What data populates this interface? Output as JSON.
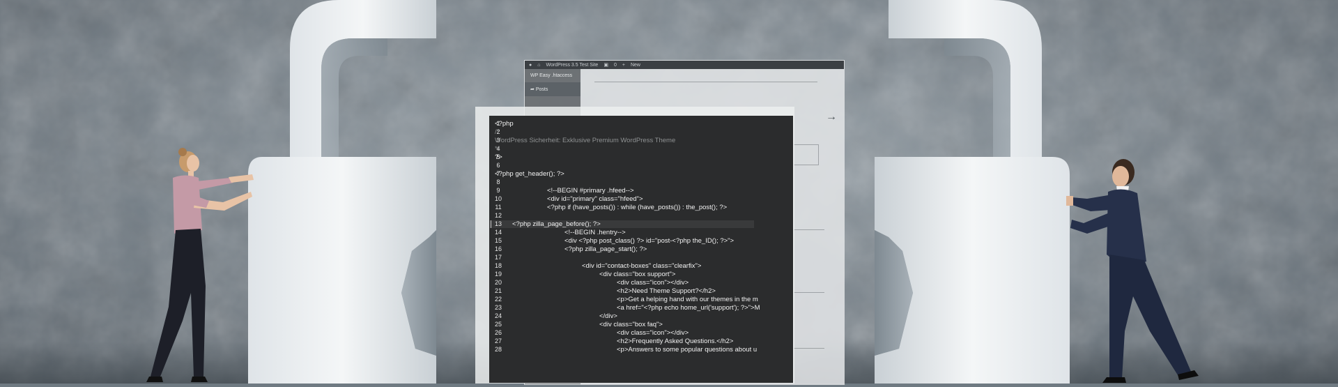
{
  "scene": {
    "description_tags": [
      "padlock-left",
      "padlock-right",
      "woman-pushing",
      "man-pushing",
      "code-editor",
      "wordpress-admin"
    ]
  },
  "wp_admin": {
    "site_title": "WordPress 3.5 Test Site",
    "comments_count": "0",
    "new_label": "New",
    "plugin_item": "WP Easy .htaccess",
    "posts_item": "Posts"
  },
  "editor": {
    "lines": [
      {
        "n": "1",
        "text": "<?php",
        "indent": 0,
        "comment": false
      },
      {
        "n": "2",
        "text": "/*",
        "indent": 0,
        "comment": true
      },
      {
        "n": "3",
        "text": "WordPress Sicherheit: Exklusive Premium WordPress Theme",
        "indent": 0,
        "comment": true
      },
      {
        "n": "4",
        "text": "*/",
        "indent": 0,
        "comment": true
      },
      {
        "n": "5",
        "text": "?>",
        "indent": 0,
        "comment": false
      },
      {
        "n": "6",
        "text": "",
        "indent": 0,
        "comment": false
      },
      {
        "n": "7",
        "text": "<?php get_header(); ?>",
        "indent": 0,
        "comment": false
      },
      {
        "n": "8",
        "text": "",
        "indent": 0,
        "comment": false
      },
      {
        "n": "9",
        "text": "<!--BEGIN #primary .hfeed-->",
        "indent": 3,
        "comment": false
      },
      {
        "n": "10",
        "text": "<div id=\"primary\" class=\"hfeed\">",
        "indent": 3,
        "comment": false
      },
      {
        "n": "11",
        "text": "<?php if (have_posts()) : while (have_posts()) : the_post(); ?>",
        "indent": 3,
        "comment": false
      },
      {
        "n": "12",
        "text": "",
        "indent": 0,
        "comment": false
      },
      {
        "n": "13",
        "text": "<?php zilla_page_before(); ?>",
        "indent": 1,
        "comment": false
      },
      {
        "n": "14",
        "text": "<!--BEGIN .hentry-->",
        "indent": 4,
        "comment": false
      },
      {
        "n": "15",
        "text": "<div <?php post_class() ?> id=\"post-<?php the_ID(); ?>\">",
        "indent": 4,
        "comment": false
      },
      {
        "n": "16",
        "text": "<?php zilla_page_start(); ?>",
        "indent": 4,
        "comment": false
      },
      {
        "n": "17",
        "text": "",
        "indent": 0,
        "comment": false
      },
      {
        "n": "18",
        "text": "<div id=\"contact-boxes\" class=\"clearfix\">",
        "indent": 5,
        "comment": false
      },
      {
        "n": "19",
        "text": "<div class=\"box support\">",
        "indent": 6,
        "comment": false
      },
      {
        "n": "20",
        "text": "<div class=\"icon\"></div>",
        "indent": 7,
        "comment": false
      },
      {
        "n": "21",
        "text": "<h2>Need Theme Support?</h2>",
        "indent": 7,
        "comment": false
      },
      {
        "n": "22",
        "text": "<p>Get a helping hand with our themes in the m",
        "indent": 7,
        "comment": false
      },
      {
        "n": "23",
        "text": "<a href=\"<?php echo home_url('support'); ?>\">M",
        "indent": 7,
        "comment": false
      },
      {
        "n": "24",
        "text": "</div>",
        "indent": 6,
        "comment": false
      },
      {
        "n": "25",
        "text": "<div class=\"box faq\">",
        "indent": 6,
        "comment": false
      },
      {
        "n": "26",
        "text": "<div class=\"icon\"></div>",
        "indent": 7,
        "comment": false
      },
      {
        "n": "27",
        "text": "<h2>Frequently Asked Questions.</h2>",
        "indent": 7,
        "comment": false
      },
      {
        "n": "28",
        "text": "<p>Answers to some popular questions about u",
        "indent": 7,
        "comment": false
      }
    ],
    "gutter_numbers": [
      "1",
      "2",
      "3",
      "4",
      "5",
      "6",
      "7",
      "8",
      "9",
      "10",
      "11",
      "12",
      "13",
      "14",
      "15",
      "16",
      "17",
      "18",
      "19",
      "20",
      "21",
      "22",
      "23",
      "24",
      "25",
      "26",
      "27",
      "28"
    ],
    "highlight_line": "13"
  },
  "colors": {
    "wall": "#7c868e",
    "lock": "#e9edf0",
    "code_bg": "#2b2c2d",
    "code_text": "#f2f2f2",
    "comment_text": "#8f9293"
  }
}
